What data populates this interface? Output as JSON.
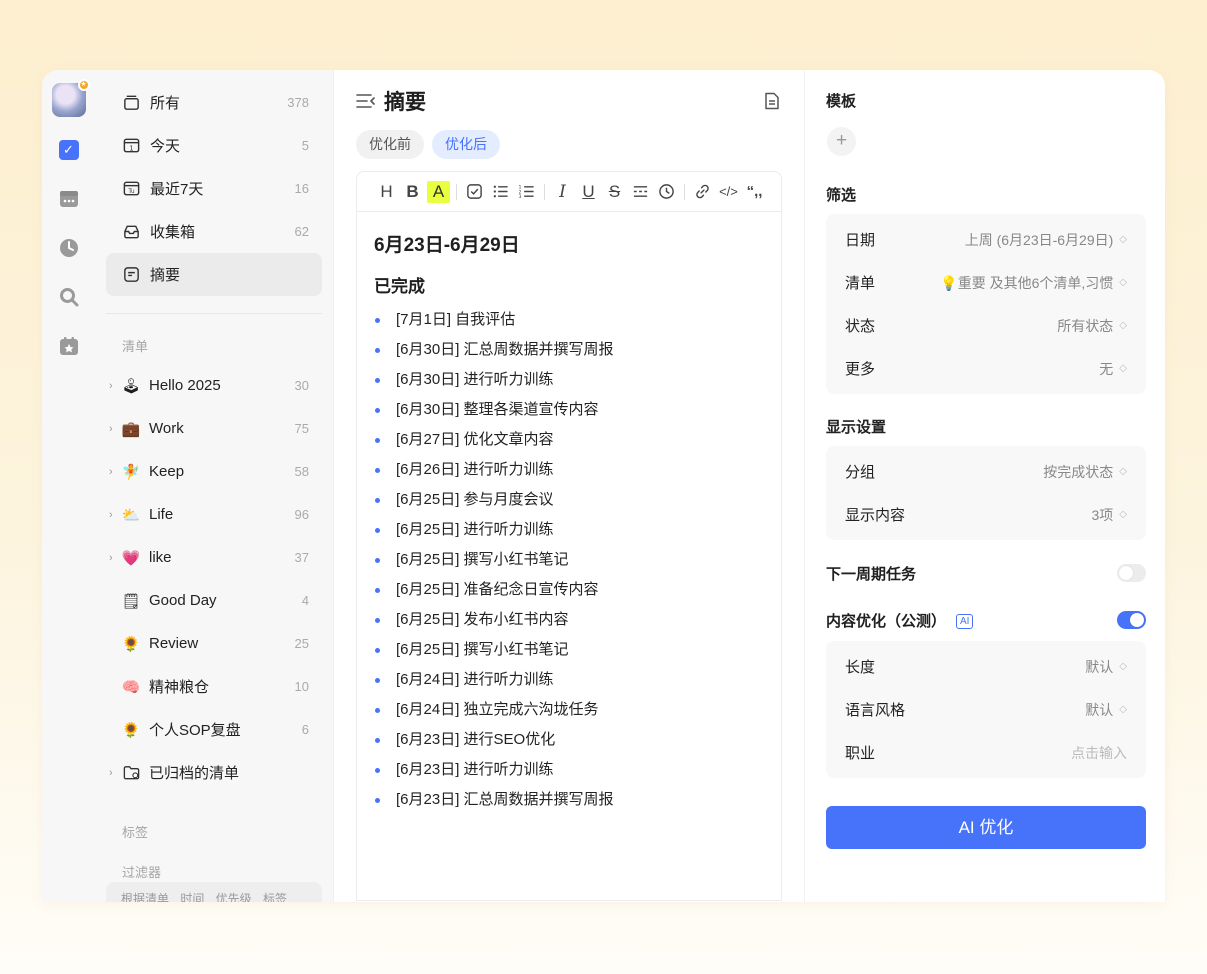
{
  "rail": {
    "items": [
      "avatar",
      "tasks-icon",
      "calendar-icon",
      "pomodoro-icon",
      "search-icon",
      "habit-icon"
    ]
  },
  "sidebar": {
    "smart_lists": [
      {
        "label": "所有",
        "count": "378",
        "icon": "inbox-stack-icon"
      },
      {
        "label": "今天",
        "count": "5",
        "icon": "today-icon"
      },
      {
        "label": "最近7天",
        "count": "16",
        "icon": "next7days-icon"
      },
      {
        "label": "收集箱",
        "count": "62",
        "icon": "inbox-icon"
      },
      {
        "label": "摘要",
        "count": "",
        "icon": "summary-icon"
      }
    ],
    "lists_title": "清单",
    "lists": [
      {
        "label": "Hello 2025",
        "count": "30",
        "emoji": "🕹",
        "chev": "›"
      },
      {
        "label": "Work",
        "count": "75",
        "emoji": "💼",
        "chev": "›"
      },
      {
        "label": "Keep",
        "count": "58",
        "emoji": "🧚",
        "chev": "›"
      },
      {
        "label": "Life",
        "count": "96",
        "emoji": "⛅",
        "chev": "›"
      },
      {
        "label": "like",
        "count": "37",
        "emoji": "💗",
        "chev": "›"
      },
      {
        "label": "Good Day",
        "count": "4",
        "emoji": "🗒",
        "chev": ""
      },
      {
        "label": "Review",
        "count": "25",
        "emoji": "🌻",
        "chev": ""
      },
      {
        "label": "精神粮仓",
        "count": "10",
        "emoji": "🧠",
        "chev": ""
      },
      {
        "label": "个人SOP复盘",
        "count": "6",
        "emoji": "🌻",
        "chev": ""
      },
      {
        "label": "已归档的清单",
        "count": "",
        "emoji": "🗂",
        "chev": "›"
      }
    ],
    "tags_title": "标签",
    "filters_title": "过滤器",
    "filter_hint": "根据清单 时间 优先级 标签"
  },
  "main": {
    "title": "摘要",
    "tabs": [
      {
        "label": "优化前",
        "active": false
      },
      {
        "label": "优化后",
        "active": true
      }
    ],
    "toolbar": [
      "H",
      "B",
      "A",
      "☑",
      "☰",
      "☷",
      "I",
      "U",
      "S",
      "≡",
      "⟲",
      "🔗",
      "</>",
      "“,,"
    ],
    "heading": "6月23日-6月29日",
    "subheading": "已完成",
    "items": [
      "[7月1日] 自我评估",
      "[6月30日] 汇总周数据并撰写周报",
      "[6月30日] 进行听力训练",
      "[6月30日] 整理各渠道宣传内容",
      "[6月27日] 优化文章内容",
      "[6月26日] 进行听力训练",
      "[6月25日] 参与月度会议",
      "[6月25日] 进行听力训练",
      "[6月25日] 撰写小红书笔记",
      "[6月25日] 准备纪念日宣传内容",
      "[6月25日] 发布小红书内容",
      "[6月25日] 撰写小红书笔记",
      "[6月24日] 进行听力训练",
      "[6月24日] 独立完成六沟垅任务",
      "[6月23日] 进行SEO优化",
      "[6月23日] 进行听力训练",
      "[6月23日] 汇总周数据并撰写周报"
    ]
  },
  "panel": {
    "template_title": "模板",
    "add": "+",
    "filter_title": "筛选",
    "filters": [
      {
        "k": "日期",
        "v": "上周 (6月23日-6月29日)"
      },
      {
        "k": "清单",
        "v": "💡重要 及其他6个清单,习惯"
      },
      {
        "k": "状态",
        "v": "所有状态"
      },
      {
        "k": "更多",
        "v": "无"
      }
    ],
    "display_title": "显示设置",
    "display": [
      {
        "k": "分组",
        "v": "按完成状态"
      },
      {
        "k": "显示内容",
        "v": "3项"
      }
    ],
    "next_cycle_label": "下一周期任务",
    "next_cycle_on": false,
    "optimize_label": "内容优化（公测）",
    "ai_badge": "AI",
    "optimize_on": true,
    "optimize": [
      {
        "k": "长度",
        "v": "默认",
        "dot": true
      },
      {
        "k": "语言风格",
        "v": "默认",
        "dot": true
      },
      {
        "k": "职业",
        "v": "点击输入",
        "dot": false
      }
    ],
    "ai_button": "AI 优化"
  },
  "colors": {
    "accent": "#4772fa",
    "highlight": "#e7ff3c"
  }
}
